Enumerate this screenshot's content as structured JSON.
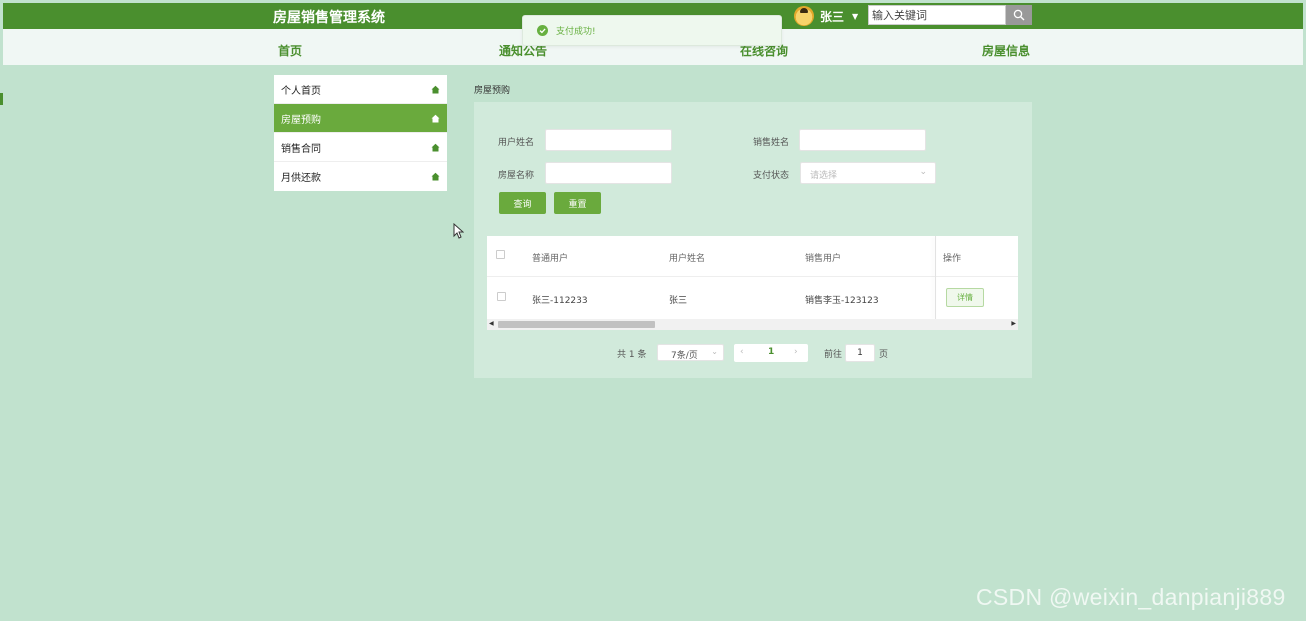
{
  "header": {
    "app_title": "房屋销售管理系统",
    "user_name": "张三",
    "search_placeholder": "输入关键词"
  },
  "nav": {
    "items": [
      "首页",
      "通知公告",
      "在线咨询",
      "房屋信息"
    ]
  },
  "toast": {
    "message": "支付成功!"
  },
  "sidebar": {
    "items": [
      {
        "label": "个人首页",
        "active": false
      },
      {
        "label": "房屋预购",
        "active": true
      },
      {
        "label": "销售合同",
        "active": false
      },
      {
        "label": "月供还款",
        "active": false
      }
    ]
  },
  "breadcrumb": "房屋预购",
  "form": {
    "user_name_label": "用户姓名",
    "sales_name_label": "销售姓名",
    "house_name_label": "房屋名称",
    "pay_status_label": "支付状态",
    "pay_status_placeholder": "请选择",
    "query_label": "查询",
    "reset_label": "重置"
  },
  "table": {
    "headers": [
      "普通用户",
      "用户姓名",
      "销售用户",
      "操作"
    ],
    "rows": [
      {
        "user": "张三-112233",
        "user_name": "张三",
        "sales_user": "销售李玉-123123",
        "action": "详情"
      }
    ]
  },
  "pagination": {
    "total_text": "共 1 条",
    "page_size": "7条/页",
    "current_page": "1",
    "goto_prefix": "前往",
    "goto_value": "1",
    "goto_suffix": "页"
  },
  "watermark": "CSDN @weixin_danpianji889",
  "colors": {
    "primary": "#4a8f2e",
    "accent": "#6aaa3d",
    "background": "#c1e2ce",
    "panel": "#d1eadb"
  }
}
